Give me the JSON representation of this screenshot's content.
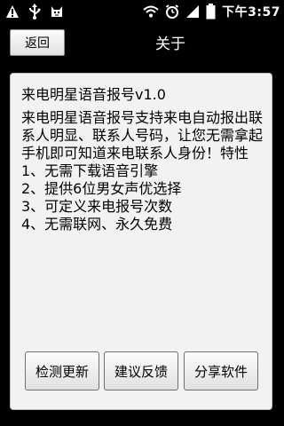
{
  "statusbar": {
    "time": "下午3:57",
    "left_icons": [
      "warning-icon",
      "usb-icon",
      "cat-face-icon"
    ],
    "right_icons": [
      "wifi-icon",
      "alarm-icon",
      "signal-icon",
      "battery-icon"
    ]
  },
  "header": {
    "back_label": "返回",
    "title": "关于"
  },
  "main": {
    "app_title": "来电明星语音报号v1.0",
    "description": "来电明星语音报号支持来电自动报出联系人明显、联系人号码，让您无需拿起手机即可知道来电联系人身份！特性\n1、无需下载语音引擎\n2、提供6位男女声优选择\n3、可定义来电报号次数\n4、无需联网、永久免费",
    "buttons": {
      "check_update": "检测更新",
      "feedback": "建议反馈",
      "share": "分享软件"
    }
  },
  "colors": {
    "background": "#000000",
    "panel": "#f2f2f2",
    "text": "#000000"
  }
}
